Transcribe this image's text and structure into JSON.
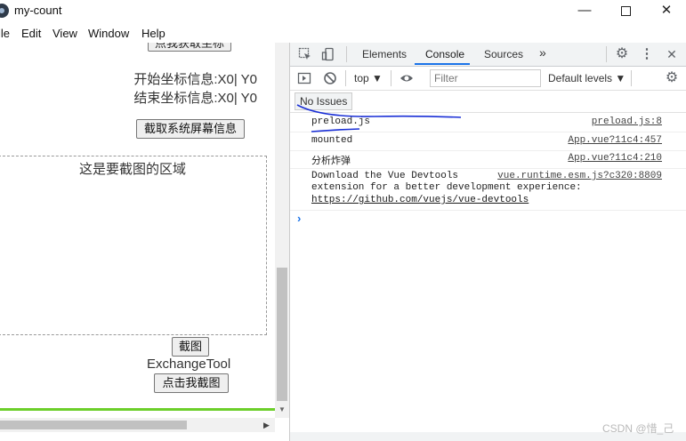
{
  "window": {
    "title": "my-count",
    "minimize_glyph": "—",
    "close_glyph": "✕"
  },
  "menu": [
    "ile",
    "Edit",
    "View",
    "Window",
    "Help"
  ],
  "app": {
    "top_button_label": "点我获取坐标",
    "coord_start": "开始坐标信息:X0| Y0",
    "coord_end": "结束坐标信息:X0| Y0",
    "sysinfo_button": "截取系统屏幕信息",
    "area_label": "这是要截图的区域",
    "screenshot_button": "截图",
    "tool_label": "ExchangeTool",
    "click_capture_button": "点击我截图"
  },
  "devtools": {
    "tabs": [
      "Elements",
      "Console",
      "Sources"
    ],
    "active_tab": "Console",
    "more_tabs_glyph": "»",
    "context": "top ▼",
    "filter_placeholder": "Filter",
    "levels": "Default levels ▼",
    "issues": "No Issues",
    "logs": [
      {
        "message": "preload.js",
        "source": "preload.js:8"
      },
      {
        "message": "mounted",
        "source": "App.vue?11c4:457"
      },
      {
        "message": "分析炸弹",
        "source": "App.vue?11c4:210"
      },
      {
        "message": "Download the Vue Devtools",
        "message_line2": "extension for a better development experience:",
        "link": "https://github.com/vuejs/vue-devtools",
        "source": "vue.runtime.esm.js?c320:8809"
      }
    ],
    "prompt": "›",
    "accent": "#1a73e8"
  },
  "watermark": "CSDN @惜_己"
}
